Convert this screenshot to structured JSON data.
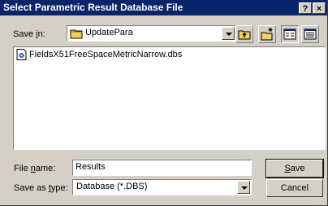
{
  "window": {
    "title": "Select Parametric Result Database File",
    "help_label": "?",
    "close_label": "×"
  },
  "save_in": {
    "label_prefix": "Save ",
    "label_key": "i",
    "label_suffix": "n:",
    "value": "UpdatePara"
  },
  "toolbar": {
    "icons": [
      "up-folder-icon",
      "new-folder-icon",
      "list-view-icon",
      "details-view-icon"
    ]
  },
  "files": [
    {
      "name": "FieldsX51FreeSpaceMetricNarrow.dbs",
      "icon": "database-file-icon"
    }
  ],
  "file_name": {
    "label_prefix": "File ",
    "label_key": "n",
    "label_suffix": "ame:",
    "value": "Results"
  },
  "save_as_type": {
    "label_prefix": "Save as ",
    "label_key": "t",
    "label_suffix": "ype:",
    "value": "Database (*.DBS)"
  },
  "buttons": {
    "save_key": "S",
    "save_rest": "ave",
    "cancel": "Cancel"
  },
  "colors": {
    "titlebar": "#0a246a",
    "face": "#d4d0c8",
    "folder": "#f2d060"
  }
}
